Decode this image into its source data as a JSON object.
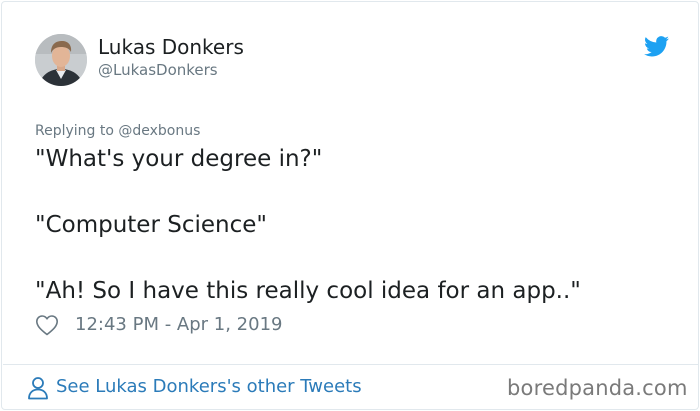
{
  "author": {
    "display_name": "Lukas Donkers",
    "handle": "@LukasDonkers"
  },
  "tweet": {
    "reply_context": "Replying to @dexbonus",
    "lines": [
      "\"What's your degree in?\"",
      "\"Computer Science\"",
      "\"Ah! So I have this really cool idea for an app..\""
    ],
    "timestamp": "12:43 PM - Apr 1, 2019"
  },
  "footer": {
    "other_tweets_link": "See Lukas Donkers's other Tweets",
    "watermark": "boredpanda.com"
  },
  "icons": {
    "brand": "twitter-bird-icon",
    "like": "heart-outline-icon",
    "profile": "user-outline-icon"
  },
  "colors": {
    "twitter_blue": "#1da1f2",
    "link_blue": "#2b7bb9",
    "text_dark": "#1c2022",
    "text_muted": "#697882",
    "border": "#e1e8ed",
    "watermark": "#7a7a7a"
  }
}
